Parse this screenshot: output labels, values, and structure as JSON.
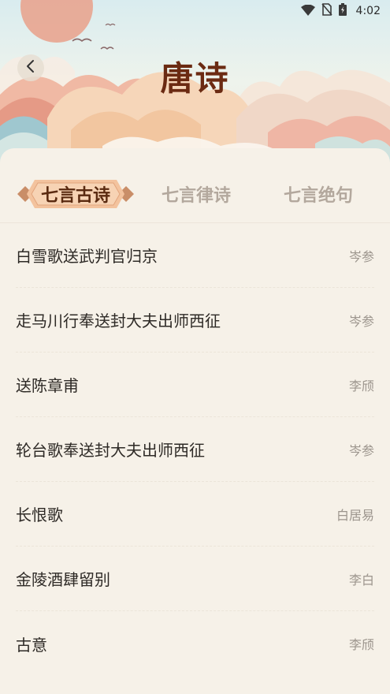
{
  "status_bar": {
    "time": "4:02"
  },
  "header": {
    "title": "唐诗"
  },
  "tabs": [
    {
      "label": "七言古诗",
      "active": true
    },
    {
      "label": "七言律诗",
      "active": false
    },
    {
      "label": "七言绝句",
      "active": false
    }
  ],
  "poems": [
    {
      "title": "白雪歌送武判官归京",
      "author": "岑参"
    },
    {
      "title": "走马川行奉送封大夫出师西征",
      "author": "岑参"
    },
    {
      "title": "送陈章甫",
      "author": "李颀"
    },
    {
      "title": "轮台歌奉送封大夫出师西征",
      "author": "岑参"
    },
    {
      "title": "长恨歌",
      "author": "白居易"
    },
    {
      "title": "金陵酒肆留别",
      "author": "李白"
    },
    {
      "title": "古意",
      "author": "李颀"
    }
  ],
  "colors": {
    "title": "#6b2a12",
    "tab_active": "#5a2a10",
    "tab_inactive": "#b3a89d",
    "background": "#f6f1e8"
  }
}
